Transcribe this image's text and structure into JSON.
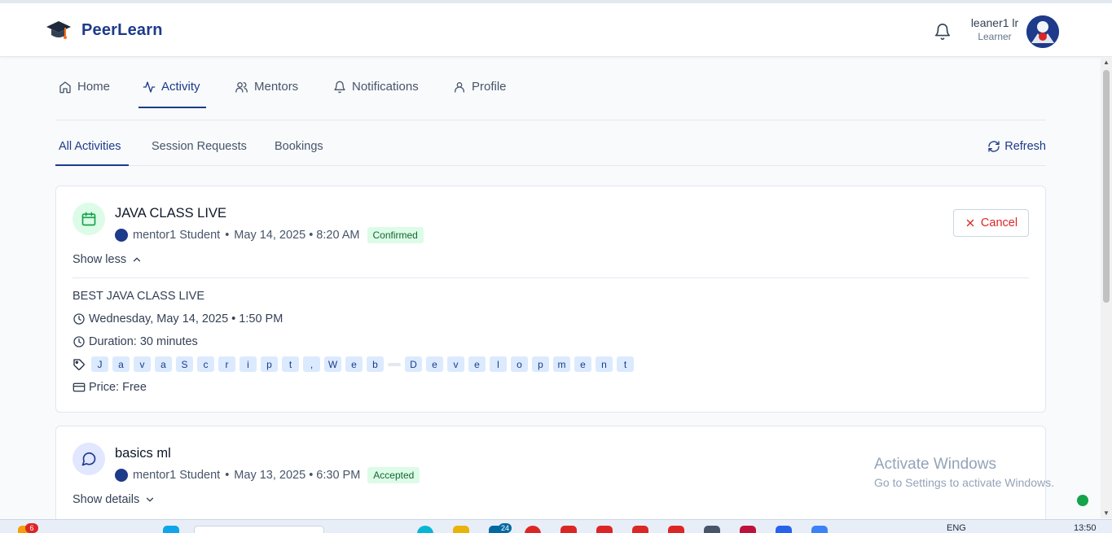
{
  "header": {
    "logo_text": "PeerLearn",
    "user_name": "leaner1 lr",
    "user_role": "Learner"
  },
  "nav": {
    "items": [
      {
        "label": "Home",
        "icon": "home-icon"
      },
      {
        "label": "Activity",
        "icon": "activity-icon",
        "active": true
      },
      {
        "label": "Mentors",
        "icon": "users-icon"
      },
      {
        "label": "Notifications",
        "icon": "bell-icon"
      },
      {
        "label": "Profile",
        "icon": "user-icon"
      }
    ]
  },
  "subtabs": {
    "items": [
      {
        "label": "All Activities",
        "active": true
      },
      {
        "label": "Session Requests"
      },
      {
        "label": "Bookings"
      }
    ],
    "refresh_label": "Refresh"
  },
  "activities": [
    {
      "title": "JAVA CLASS LIVE",
      "mentor": "mentor1 Student",
      "datetime": "May 14, 2025 • 8:20 AM",
      "status": "Confirmed",
      "toggle_label": "Show less",
      "cancel_label": "Cancel",
      "description": "BEST JAVA CLASS LIVE",
      "schedule": "Wednesday, May 14, 2025 • 1:50 PM",
      "duration": "Duration: 30 minutes",
      "tags": [
        "J",
        "a",
        "v",
        "a",
        "S",
        "c",
        "r",
        "i",
        "p",
        "t",
        ",",
        "W",
        "e",
        "b",
        "",
        "D",
        "e",
        "v",
        "e",
        "l",
        "o",
        "p",
        "m",
        "e",
        "n",
        "t"
      ],
      "price": "Price: Free"
    },
    {
      "title": "basics ml",
      "mentor": "mentor1 Student",
      "datetime": "May 13, 2025 • 6:30 PM",
      "status": "Accepted",
      "toggle_label": "Show details"
    }
  ],
  "watermark": {
    "title": "Activate Windows",
    "subtitle": "Go to Settings to activate Windows."
  },
  "taskbar": {
    "badge_left": "6",
    "badge_mail": "24",
    "language": "ENG",
    "time": "13:50"
  },
  "colors": {
    "accent": "#1e3a8a",
    "danger": "#dc2626",
    "success_bg": "#dcfce7",
    "success_text": "#166534",
    "chip_bg": "#dbeafe"
  }
}
